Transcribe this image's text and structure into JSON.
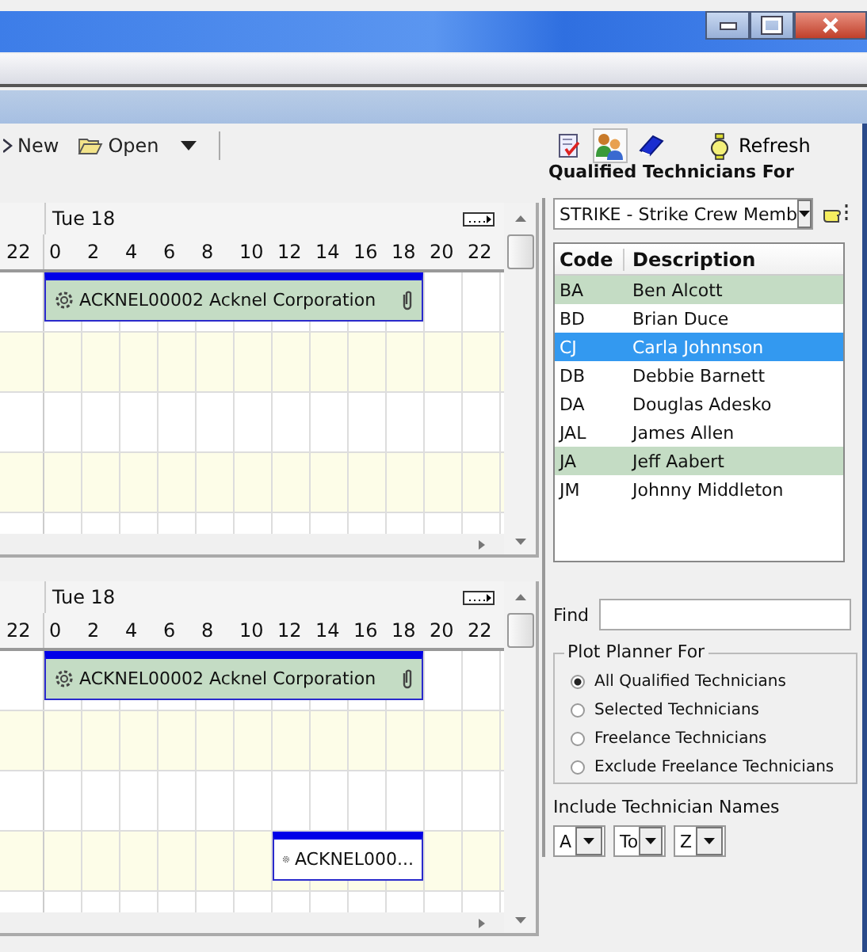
{
  "toolbar": {
    "buttons": [
      {
        "kind": "new",
        "label": "New"
      },
      {
        "kind": "open",
        "label": "Open"
      }
    ],
    "right_buttons": [
      {
        "kind": "report",
        "selected": false
      },
      {
        "kind": "people",
        "selected": true
      },
      {
        "kind": "book",
        "selected": false
      }
    ],
    "refresh": "Refresh"
  },
  "planners": [
    {
      "day": "Tue 18",
      "prev_hour": "22",
      "hours": [
        "0",
        "2",
        "4",
        "6",
        "8",
        "10",
        "12",
        "14",
        "16",
        "18",
        "20",
        "22"
      ],
      "rows": [
        {
          "events": [
            {
              "kind": "long",
              "label": "ACKNEL00002 Acknel Corporation",
              "filled": true,
              "attachment": true
            }
          ]
        },
        {
          "events": []
        },
        {
          "events": []
        },
        {
          "events": []
        },
        {
          "events": []
        }
      ]
    },
    {
      "day": "Tue 18",
      "prev_hour": "22",
      "hours": [
        "0",
        "2",
        "4",
        "6",
        "8",
        "10",
        "12",
        "14",
        "16",
        "18",
        "20",
        "22"
      ],
      "rows": [
        {
          "events": [
            {
              "kind": "long",
              "label": "ACKNEL00002 Acknel Corporation",
              "filled": true,
              "attachment": true
            }
          ]
        },
        {
          "events": []
        },
        {
          "events": []
        },
        {
          "events": [
            {
              "kind": "short",
              "label": "ACKNEL000...",
              "filled": false,
              "attachment": false
            }
          ]
        },
        {
          "events": []
        }
      ]
    }
  ],
  "panel": {
    "title": "Qualified Technicians For",
    "crew": "STRIKE  - Strike Crew Memb",
    "columns": [
      "Code",
      "Description"
    ],
    "technicians": [
      {
        "code": "BA",
        "name": "Ben Alcott",
        "selected": false,
        "highlighted": true
      },
      {
        "code": "BD",
        "name": "Brian Duce",
        "selected": false,
        "highlighted": false
      },
      {
        "code": "CJ",
        "name": "Carla Johnnson",
        "selected": true,
        "highlighted": false
      },
      {
        "code": "DB",
        "name": "Debbie Barnett",
        "selected": false,
        "highlighted": false
      },
      {
        "code": "DA",
        "name": "Douglas Adesko",
        "selected": false,
        "highlighted": false
      },
      {
        "code": "JAL",
        "name": "James Allen",
        "selected": false,
        "highlighted": false
      },
      {
        "code": "JA",
        "name": "Jeff Aabert",
        "selected": false,
        "highlighted": true
      },
      {
        "code": "JM",
        "name": "Johnny Middleton",
        "selected": false,
        "highlighted": false
      }
    ],
    "find_label": "Find",
    "group_title": "Plot Planner For",
    "options": [
      {
        "label": "All Qualified Technicians",
        "selected": true
      },
      {
        "label": "Selected Technicians",
        "selected": false
      },
      {
        "label": "Freelance Technicians",
        "selected": false
      },
      {
        "label": "Exclude Freelance Technicians",
        "selected": false
      }
    ],
    "names_label": "Include Technician Names",
    "range": [
      "A",
      "To",
      "Z"
    ]
  }
}
